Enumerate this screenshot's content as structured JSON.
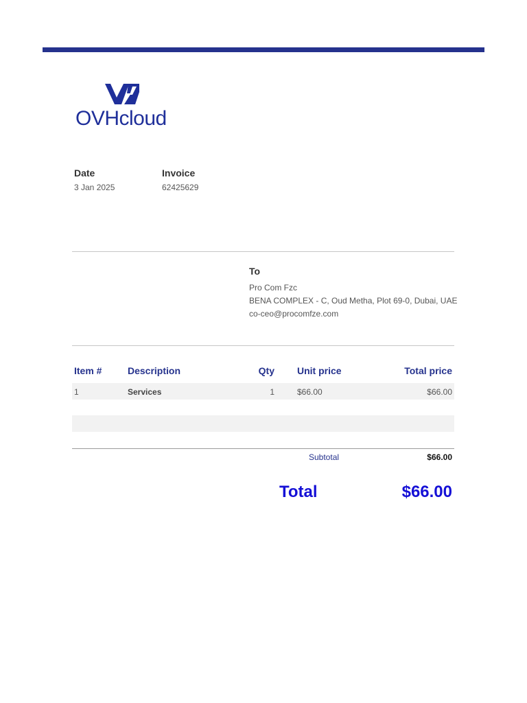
{
  "brand": {
    "name": "OVHcloud",
    "color": "#1f2f9a"
  },
  "meta": {
    "date_label": "Date",
    "date_value": "3 Jan 2025",
    "invoice_label": "Invoice",
    "invoice_value": "62425629"
  },
  "recipient": {
    "title": "To",
    "name": "Pro Com Fzc",
    "address": "BENA COMPLEX - C, Oud Metha, Plot 69-0, Dubai, UAE",
    "email": "co-ceo@procomfze.com"
  },
  "table": {
    "headers": {
      "item": "Item #",
      "description": "Description",
      "qty": "Qty",
      "unit_price": "Unit price",
      "total_price": "Total price"
    },
    "rows": [
      {
        "item": "1",
        "description": "Services",
        "qty": "1",
        "unit_price": "$66.00",
        "total_price": "$66.00"
      }
    ]
  },
  "totals": {
    "subtotal_label": "Subtotal",
    "subtotal_value": "$66.00",
    "total_label": "Total",
    "total_value": "$66.00"
  },
  "colors": {
    "accent": "#25328d",
    "total": "#1510d6"
  }
}
